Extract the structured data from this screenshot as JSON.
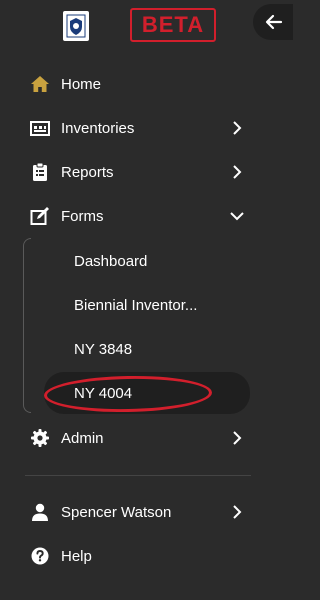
{
  "header": {
    "beta_label": "BETA"
  },
  "nav": {
    "home": "Home",
    "inventories": "Inventories",
    "reports": "Reports",
    "forms": "Forms",
    "admin": "Admin"
  },
  "forms_submenu": [
    {
      "label": "Dashboard"
    },
    {
      "label": "Biennial Inventor..."
    },
    {
      "label": "NY 3848"
    },
    {
      "label": "NY 4004"
    }
  ],
  "user": {
    "name": "Spencer Watson"
  },
  "help": "Help",
  "colors": {
    "background": "#2b2b2b",
    "active_item": "#1f1f1f",
    "brand_red": "#d21f2c",
    "home_icon": "#c9a23f"
  }
}
